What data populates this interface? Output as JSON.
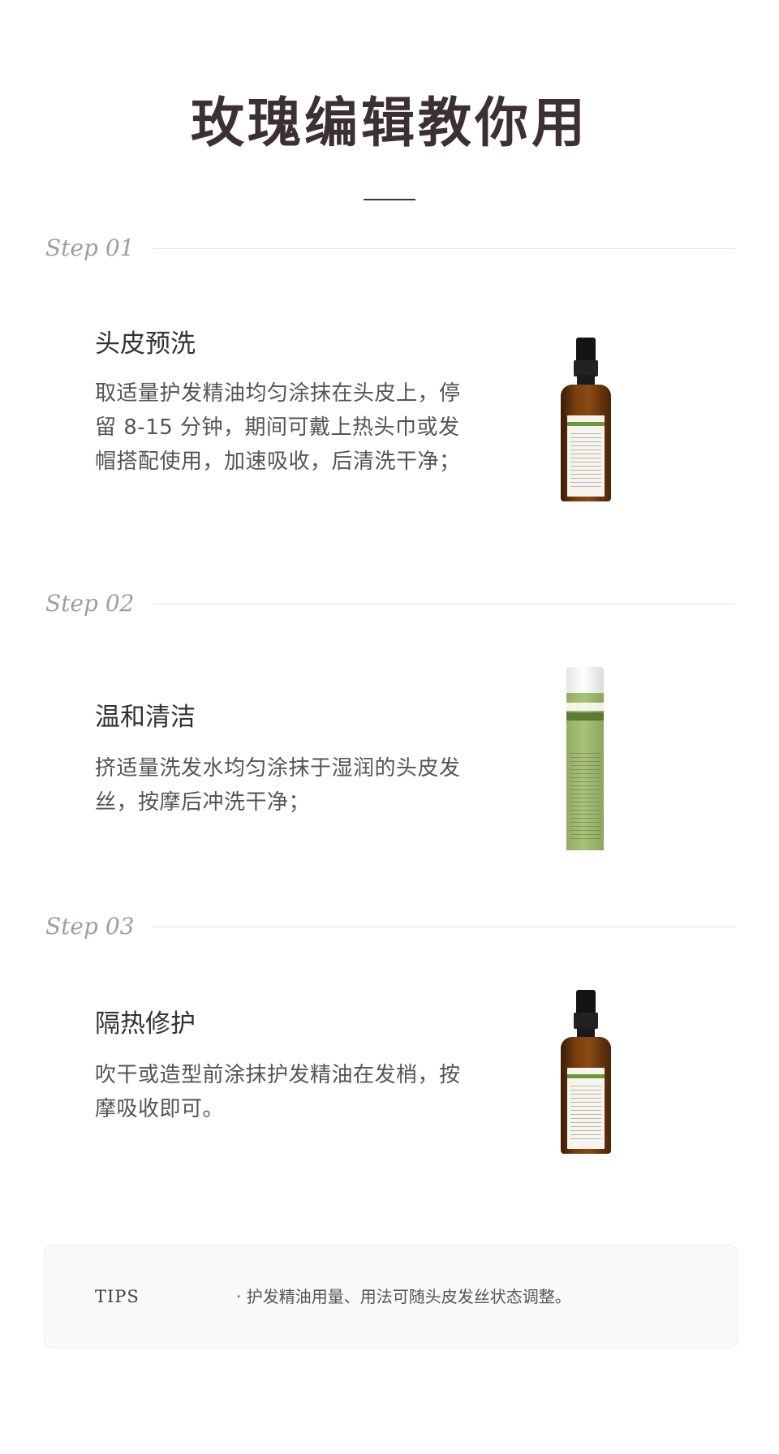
{
  "title": "玫瑰编辑教你用",
  "steps": [
    {
      "label": "Step 01",
      "title": "头皮预洗",
      "desc": "取适量护发精油均匀涂抹在头皮上，停留 8-15 分钟，期间可戴上热头巾或发帽搭配使用，加速吸收，后清洗干净；",
      "product_icon": "hair-oil-bottle"
    },
    {
      "label": "Step 02",
      "title": "温和清洁",
      "desc": "挤适量洗发水均匀涂抹于湿润的头皮发丝，按摩后冲洗干净；",
      "product_icon": "shampoo-bottle"
    },
    {
      "label": "Step 03",
      "title": "隔热修护",
      "desc": "吹干或造型前涂抹护发精油在发梢，按摩吸收即可。",
      "product_icon": "hair-oil-bottle"
    }
  ],
  "tips": {
    "label": "TIPS",
    "text": "· 护发精油用量、用法可随头皮发丝状态调整。"
  },
  "colors": {
    "title": "#3d3034",
    "step_label": "#a29c9d",
    "oil_amber": "#7a3f0d",
    "shampoo_green": "#a9c27a"
  }
}
